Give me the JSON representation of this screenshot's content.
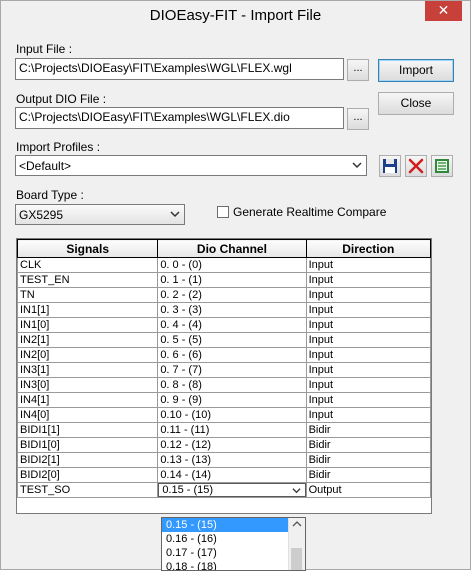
{
  "window": {
    "title": "DIOEasy-FIT - Import File",
    "close_glyph": "✕"
  },
  "input_file": {
    "label": "Input File :",
    "value": "C:\\Projects\\DIOEasy\\FIT\\Examples\\WGL\\FLEX.wgl",
    "browse_label": "..."
  },
  "output_file": {
    "label": "Output DIO File :",
    "value": "C:\\Projects\\DIOEasy\\FIT\\Examples\\WGL\\FLEX.dio",
    "browse_label": "..."
  },
  "buttons": {
    "import": "Import",
    "close": "Close"
  },
  "import_profiles": {
    "label": "Import Profiles :",
    "selected": "<Default>",
    "icons": [
      "save-icon",
      "delete-icon",
      "profile-list-icon"
    ]
  },
  "board_type": {
    "label": "Board Type :",
    "selected": "GX5295"
  },
  "realtime_compare": {
    "label": "Generate Realtime Compare",
    "checked": false
  },
  "table": {
    "headers": [
      "Signals",
      "Dio Channel",
      "Direction"
    ],
    "rows": [
      [
        "CLK",
        "0. 0 - (0)",
        "Input"
      ],
      [
        "TEST_EN",
        "0. 1 - (1)",
        "Input"
      ],
      [
        "TN",
        "0. 2 - (2)",
        "Input"
      ],
      [
        "IN1[1]",
        "0. 3 - (3)",
        "Input"
      ],
      [
        "IN1[0]",
        "0. 4 - (4)",
        "Input"
      ],
      [
        "IN2[1]",
        "0. 5 - (5)",
        "Input"
      ],
      [
        "IN2[0]",
        "0. 6 - (6)",
        "Input"
      ],
      [
        "IN3[1]",
        "0. 7 - (7)",
        "Input"
      ],
      [
        "IN3[0]",
        "0. 8 - (8)",
        "Input"
      ],
      [
        "IN4[1]",
        "0. 9 - (9)",
        "Input"
      ],
      [
        "IN4[0]",
        "0.10 - (10)",
        "Input"
      ],
      [
        "BIDI1[1]",
        "0.11 - (11)",
        "Bidir"
      ],
      [
        "BIDI1[0]",
        "0.12 - (12)",
        "Bidir"
      ],
      [
        "BIDI2[1]",
        "0.13 - (13)",
        "Bidir"
      ],
      [
        "BIDI2[0]",
        "0.14 - (14)",
        "Bidir"
      ],
      [
        "TEST_SO",
        "0.15 - (15)",
        "Output"
      ]
    ]
  },
  "channel_dropdown": {
    "options": [
      "0.15 - (15)",
      "0.16 - (16)",
      "0.17 - (17)",
      "0.18 - (18)"
    ],
    "selected_index": 0
  }
}
